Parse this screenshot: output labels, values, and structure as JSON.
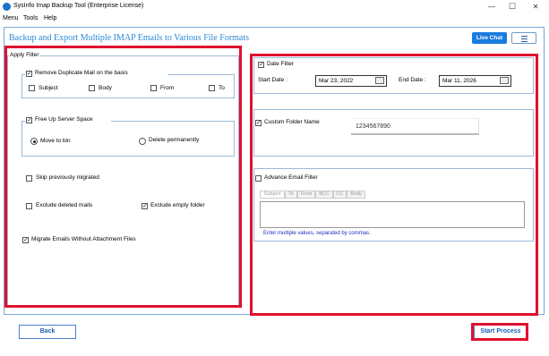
{
  "window": {
    "title": "SysInfo Imap Backup Tool (Enterprise License)",
    "minimize": "—",
    "maximize": "☐",
    "close": "✕"
  },
  "menu": [
    "Menu",
    "Tools",
    "Help"
  ],
  "header": {
    "heading": "Backup and Export Multiple IMAP Emails to Various File Formats",
    "live_chat": "Live Chat"
  },
  "apply_filter": {
    "legend": "Apply Filter",
    "remove_duplicate": {
      "label": "Remove Duplicate Mail on the basis",
      "checked": true,
      "options": [
        {
          "label": "Subject",
          "checked": false
        },
        {
          "label": "Body",
          "checked": false
        },
        {
          "label": "From",
          "checked": false
        },
        {
          "label": "To",
          "checked": false
        }
      ]
    },
    "free_up": {
      "label": "Free Up Server Space",
      "checked": true,
      "move_to_bin": "Move to bin",
      "delete_permanently": "Delete permanently",
      "selected": "Move to bin"
    },
    "skip_migrated": {
      "label": "Skip previously migrated",
      "checked": false
    },
    "exclude_deleted": {
      "label": "Exclude deleted mails",
      "checked": false
    },
    "exclude_empty": {
      "label": "Exclude empty folder",
      "checked": true
    },
    "migrate_without_attachment": {
      "label": "Migrate Emails Without Attachment Files",
      "checked": true
    }
  },
  "date_filter": {
    "label": "Date Filter",
    "checked": true,
    "start_label": "Start Date :",
    "start_value": "Mar 23, 2022",
    "end_label": "End Date :",
    "end_value": "Mar 11, 2026"
  },
  "custom_folder": {
    "label": "Custom Folder Name",
    "checked": true,
    "value": "1234567890"
  },
  "advance_filter": {
    "label": "Advance Email Filter",
    "checked": false,
    "tabs": [
      "Subject",
      "To",
      "From",
      "BCC",
      "CC",
      "Body"
    ],
    "active_tab": "Subject",
    "hint": "Enter multiple values, separated by commas."
  },
  "footer": {
    "back": "Back",
    "start_process": "Start Process"
  }
}
